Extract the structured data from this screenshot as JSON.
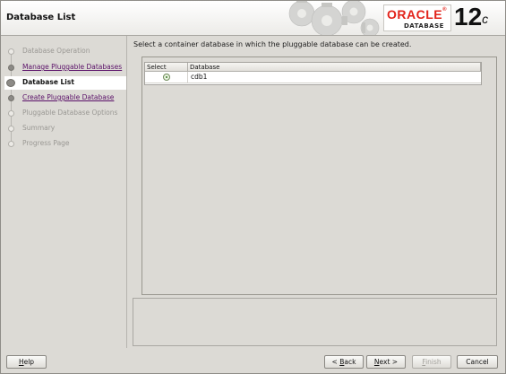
{
  "header": {
    "title": "Database List",
    "brand": "ORACLE",
    "brand_mark": "®",
    "brand_sub": "DATABASE",
    "version": "12",
    "version_sup": "c"
  },
  "nav": {
    "steps": [
      {
        "label": "Database Operation",
        "state": "done"
      },
      {
        "label": "Manage Pluggable Databases",
        "state": "link"
      },
      {
        "label": "Database List",
        "state": "current"
      },
      {
        "label": "Create Pluggable Database",
        "state": "link"
      },
      {
        "label": "Pluggable Database Options",
        "state": "pending"
      },
      {
        "label": "Summary",
        "state": "pending"
      },
      {
        "label": "Progress Page",
        "state": "pending"
      }
    ]
  },
  "content": {
    "instruction": "Select a container database in which the pluggable database can be created.",
    "table": {
      "headers": [
        "Select",
        "Database"
      ],
      "rows": [
        {
          "selected": true,
          "database": "cdb1"
        }
      ]
    }
  },
  "buttons": {
    "help": {
      "mnemonic": "H",
      "rest": "elp"
    },
    "back": {
      "prefix": "< ",
      "mnemonic": "B",
      "rest": "ack"
    },
    "next": {
      "mnemonic": "N",
      "rest": "ext >"
    },
    "finish": {
      "mnemonic": "F",
      "rest": "inish"
    },
    "cancel": {
      "label": "Cancel"
    }
  },
  "colors": {
    "brand_red": "#e2231a",
    "link_purple": "#5a1068"
  }
}
